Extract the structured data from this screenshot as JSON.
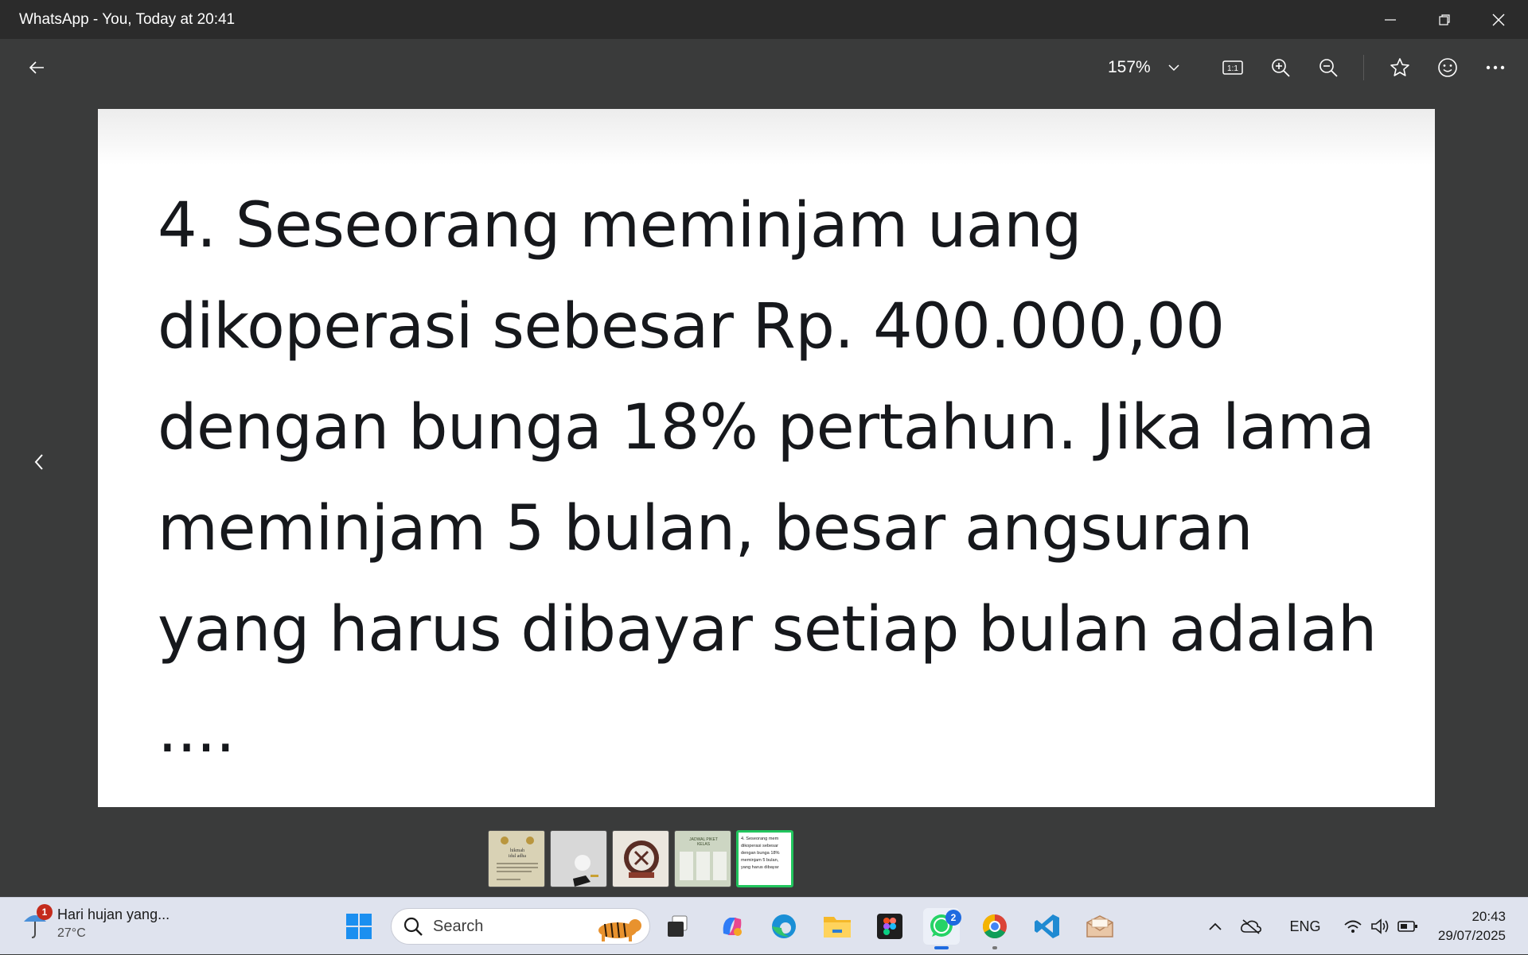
{
  "window": {
    "title": "WhatsApp - You, Today at 20:41"
  },
  "toolbar": {
    "zoom_level": "157%"
  },
  "image": {
    "lines": [
      "4. Seseorang meminjam uang",
      "dikoperasi sebesar Rp. 400.000,00",
      "dengan bunga 18% pertahun. Jika lama",
      "meminjam 5 bulan, besar angsuran",
      "yang harus dibayar setiap bulan adalah",
      "...."
    ]
  },
  "filmstrip": {
    "thumbs": [
      {
        "label": "hikmah idul adha",
        "color": "#d8d2b8"
      },
      {
        "label": "",
        "color": "#d6d6d6"
      },
      {
        "label": "",
        "color": "#e9e4dc"
      },
      {
        "label": "JADWAL PIKET KELAS",
        "color": "#cfd7c6"
      },
      {
        "label": "4. Seseorang mem dikoperasi sebesar dengan bunga 18% meminjam 5 bulan, yang harus dibayar",
        "color": "#ffffff"
      }
    ]
  },
  "taskbar": {
    "weather_title": "Hari hujan yang...",
    "weather_temp": "27°C",
    "weather_badge": "1",
    "search_placeholder": "Search",
    "whatsapp_badge": "2",
    "language": "ENG",
    "time": "20:43",
    "date": "29/07/2025"
  }
}
